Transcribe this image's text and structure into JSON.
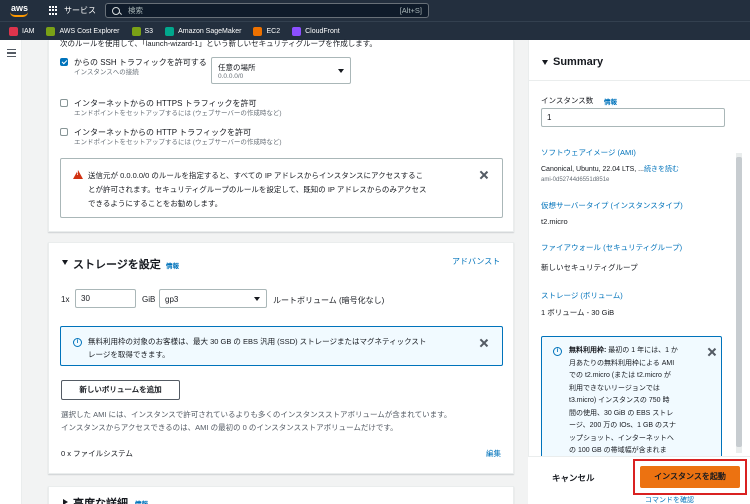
{
  "topnav": {
    "logo": "aws",
    "services": "サービス",
    "search_placeholder": "検索",
    "search_shortcut": "[Alt+S]"
  },
  "favorites": [
    {
      "label": "IAM",
      "color": "#dd344c"
    },
    {
      "label": "AWS Cost Explorer",
      "color": "#7aa116"
    },
    {
      "label": "S3",
      "color": "#7aa116"
    },
    {
      "label": "Amazon SageMaker",
      "color": "#01a88d"
    },
    {
      "label": "EC2",
      "color": "#ed7100"
    },
    {
      "label": "CloudFront",
      "color": "#8c4fff"
    }
  ],
  "network": {
    "truncated_top": "次のルールを使用して、「launch-wizard-1」という新しいセキュリティグループを作成します。",
    "ssh_label": "からの SSH トラフィックを許可する",
    "ssh_sub": "インスタンスへの接続",
    "ssh_source_label": "任意の場所",
    "ssh_source_value": "0.0.0.0/0",
    "https_label": "インターネットからの HTTPS トラフィックを許可",
    "https_sub": "エンドポイントをセットアップするには (ウェブサーバーの作成時など)",
    "http_label": "インターネットからの HTTP トラフィックを許可",
    "http_sub": "エンドポイントをセットアップするには (ウェブサーバーの作成時など)",
    "warning_l1": "送信元が 0.0.0.0/0 のルールを指定すると、すべての IP アドレスからインスタンスにアクセスするこ",
    "warning_l2": "とが許可されます。セキュリティグループのルールを設定して、既知の IP アドレスからのみアクセス",
    "warning_l3": "できるようにすることをお勧めします。"
  },
  "storage": {
    "title": "ストレージを設定",
    "info": "情報",
    "advanced": "アドバンスト",
    "count": "1x",
    "size": "30",
    "unit": "GiB",
    "type": "gp3",
    "root_label": "ルートボリューム (暗号化なし)",
    "info_l1": "無料利用枠の対象のお客様は、最大 30 GB の EBS 汎用 (SSD) ストレージまたはマグネティックスト",
    "info_l2": "レージを取得できます。",
    "add_volume": "新しいボリュームを追加",
    "ami_note_l1": "選択した AMI には、インスタンスで許可されているよりも多くのインスタンスストアボリュームが含まれています。",
    "ami_note_l2": "インスタンスからアクセスできるのは、AMI の最初の 0 のインスタンスストアボリュームだけです。",
    "fs_count": "0 x ファイルシステム",
    "edit": "編集"
  },
  "advanced": {
    "title": "高度な詳細",
    "info": "情報"
  },
  "summary": {
    "title": "Summary",
    "count_label": "インスタンス数",
    "count_info": "情報",
    "count_value": "1",
    "ami_label": "ソフトウェアイメージ (AMI)",
    "ami_value": "Canonical, Ubuntu, 22.04 LTS, ...",
    "ami_more": "続きを読む",
    "ami_id": "ami-0d52744d6551d851e",
    "type_label": "仮想サーバータイプ (インスタンスタイプ)",
    "type_value": "t2.micro",
    "fw_label": "ファイアウォール (セキュリティグループ)",
    "fw_value": "新しいセキュリティグループ",
    "storage_label": "ストレージ (ボリューム)",
    "storage_value": "1 ボリューム - 30 GiB",
    "free_l1_b": "無料利用枠:",
    "free_l1": " 最初の 1 年には、1 か",
    "free_l2": "月あたりの無料利用枠による AMI",
    "free_l3": "での t2.micro (または t2.micro が",
    "free_l4": "利用できないリージョンでは",
    "free_l5": "t3.micro) インスタンスの 750 時",
    "free_l6": "間の使用、30 GiB の EBS ストレ",
    "free_l7": "ージ、200 万の IOs、1 GB のスナ",
    "free_l8": "ップショット、インターネットへ",
    "free_l9": "の 100 GB の帯域幅が含まれま"
  },
  "footer": {
    "cancel": "キャンセル",
    "launch": "インスタンスを起動",
    "confirm": "コマンドを確認"
  }
}
